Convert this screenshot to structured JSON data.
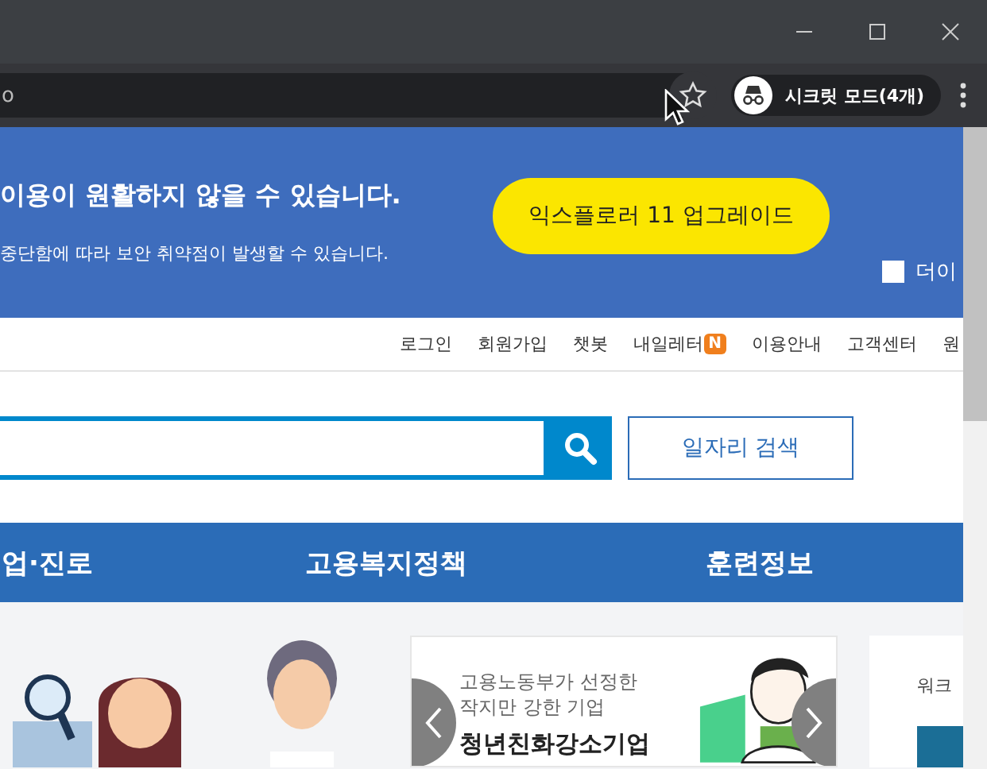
{
  "browser": {
    "address": "o",
    "bookmarked": false,
    "profile": {
      "label": "시크릿 모드(4개)"
    }
  },
  "banner": {
    "headline": "이용이 원활하지 않을 수 있습니다.",
    "subtext": "중단함에 따라 보안 취약점이 발생할 수 있습니다.",
    "button": "익스플로러 11 업그레이드",
    "checkbox": {
      "label": "더이",
      "checked": false
    }
  },
  "top_links": [
    {
      "label": "로그인"
    },
    {
      "label": "회원가입"
    },
    {
      "label": "챗봇"
    },
    {
      "label": "내일레터",
      "badge": "N"
    },
    {
      "label": "이용안내"
    },
    {
      "label": "고객센터"
    },
    {
      "label": "원"
    }
  ],
  "search": {
    "button": "일자리 검색"
  },
  "nav": [
    "업·진로",
    "고용복지정책",
    "훈련정보"
  ],
  "promo": {
    "caption": "고용노동부가 선정한\n작지만 강한 기업",
    "title": "청년친화강소기업"
  },
  "side_card": {
    "text": "워크"
  }
}
